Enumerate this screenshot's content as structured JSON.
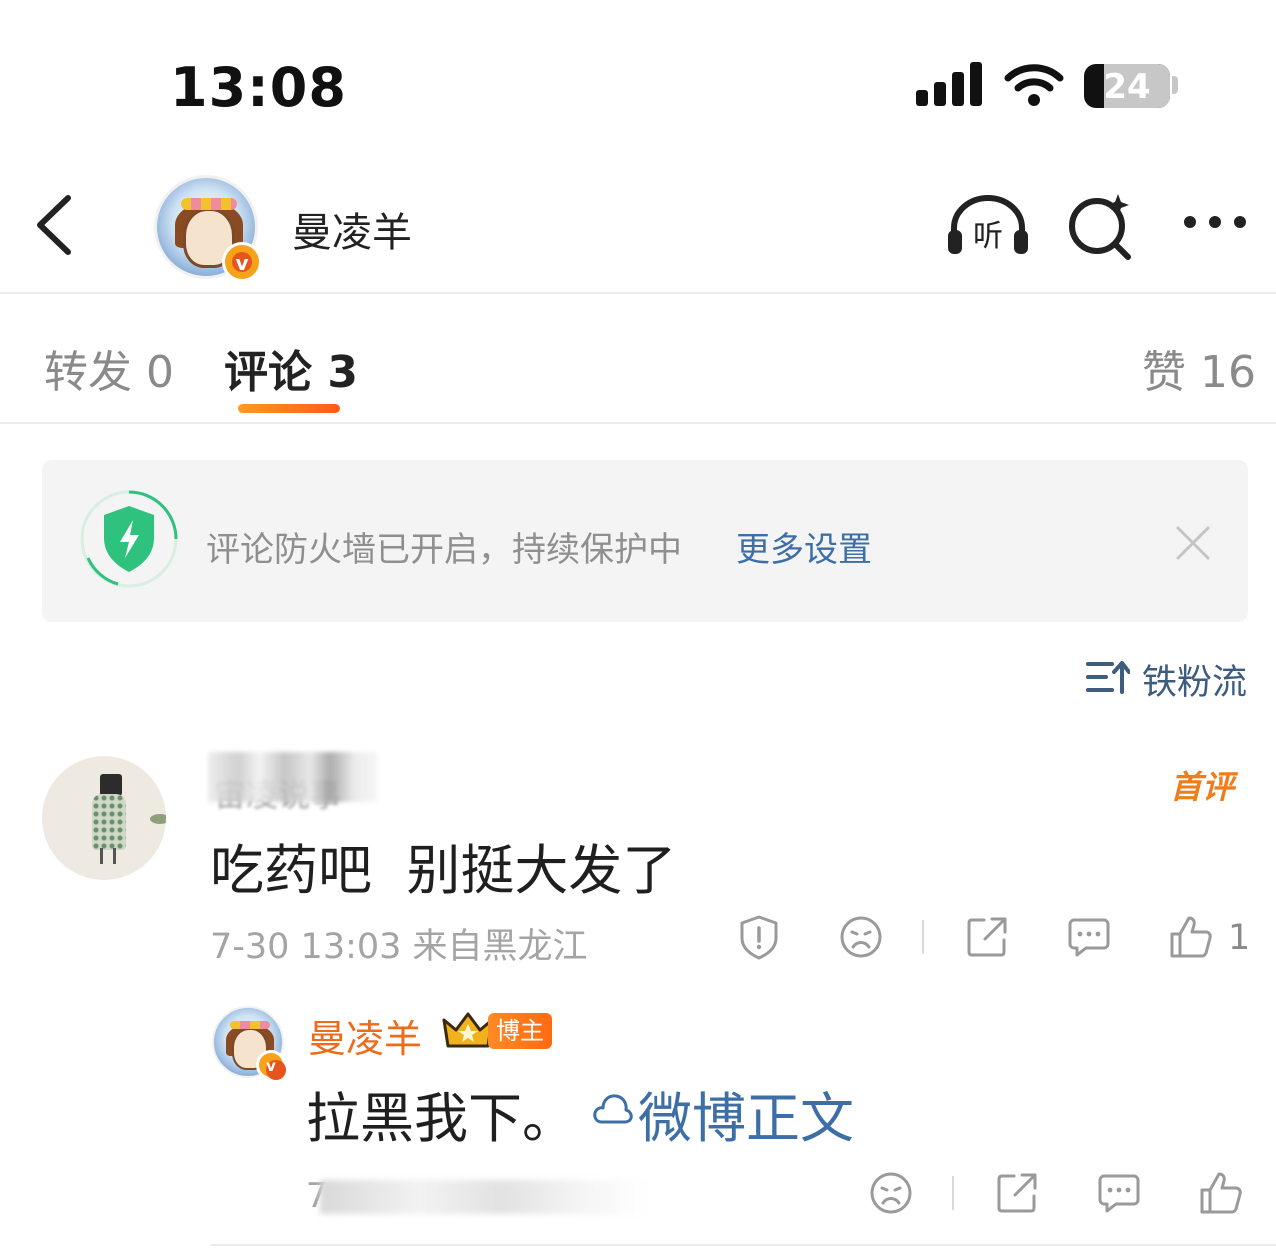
{
  "status_bar": {
    "time": "13:08",
    "battery_level": "24"
  },
  "header": {
    "title": "曼凌羊",
    "verified": true,
    "icons": [
      "back-icon",
      "listen-icon",
      "search-icon",
      "more-icon"
    ],
    "listen_label": "听"
  },
  "tabs": [
    {
      "label": "转发 0",
      "active": false
    },
    {
      "label": "评论 3",
      "active": true
    },
    {
      "label": "赞 16",
      "active": false
    }
  ],
  "firewall_banner": {
    "text": "评论防火墙已开启，持续保护中",
    "link": "更多设置"
  },
  "sort": {
    "label": "铁粉流"
  },
  "comment": {
    "username": "宙凌说事",
    "badge": "首评",
    "text": "吃药吧  别挺大发了",
    "meta": "7-30 13:03 来自黑龙江",
    "like_count": "1"
  },
  "reply": {
    "username": "曼凌羊",
    "badge": "博主",
    "text": "拉黑我下。",
    "link": "微博正文",
    "meta": "7"
  },
  "colors": {
    "accent_orange": "#ff6a10",
    "link_blue": "#3d6fa6",
    "shield_green": "#2ec27e"
  }
}
